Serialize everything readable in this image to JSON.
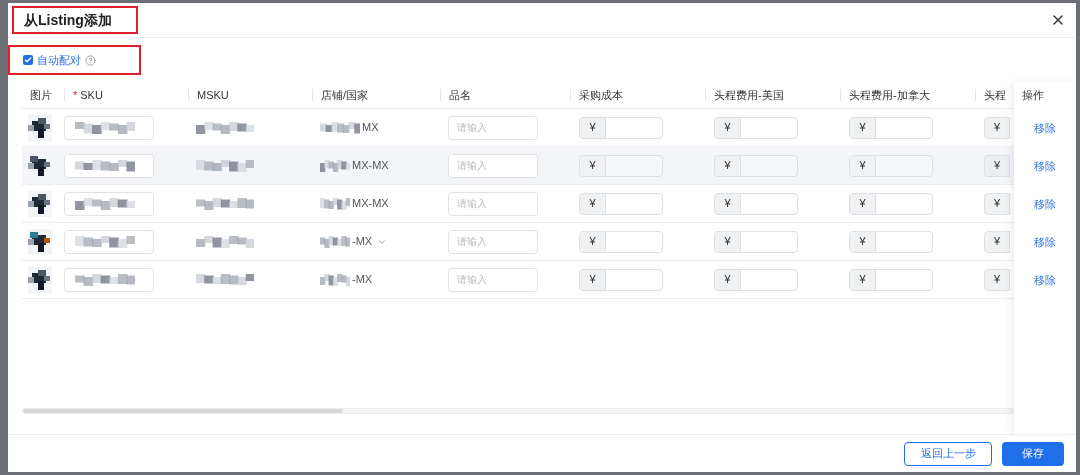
{
  "dialog": {
    "title": "从Listing添加"
  },
  "auto_match": {
    "label": "自动配对",
    "checked": true
  },
  "table": {
    "columns": [
      {
        "label": "图片"
      },
      {
        "label": "SKU",
        "kind": "sku",
        "required_mark": "*"
      },
      {
        "label": "MSKU",
        "kind": "msku"
      },
      {
        "label": "店铺/国家",
        "kind": "store"
      },
      {
        "label": "品名",
        "kind": "name"
      },
      {
        "label": "采购成本",
        "kind": "money"
      },
      {
        "label": "头程费用-美国",
        "kind": "money"
      },
      {
        "label": "头程费用-加拿大",
        "kind": "money"
      },
      {
        "label": "头程",
        "kind": "money"
      }
    ],
    "fixed_column": {
      "label": "操作"
    },
    "rows": [
      {
        "store_suffix": "MX",
        "highlighted": false,
        "name_placeholder": "请输入",
        "currency": [
          "¥",
          "¥",
          "¥",
          "¥"
        ],
        "action": "移除"
      },
      {
        "store_suffix": "MX-MX",
        "highlighted": true,
        "name_placeholder": "请输入",
        "currency": [
          "¥",
          "¥",
          "¥",
          "¥"
        ],
        "action": "移除"
      },
      {
        "store_suffix": "MX-MX",
        "highlighted": false,
        "name_placeholder": "请输入",
        "currency": [
          "¥",
          "¥",
          "¥",
          "¥"
        ],
        "action": "移除"
      },
      {
        "store_suffix": "-MX",
        "dropdown": true,
        "highlighted": false,
        "name_placeholder": "请输入",
        "currency": [
          "¥",
          "¥",
          "¥",
          "¥"
        ],
        "action": "移除"
      },
      {
        "store_suffix": "-MX",
        "highlighted": false,
        "name_placeholder": "请输入",
        "currency": [
          "¥",
          "¥",
          "¥",
          "¥"
        ],
        "action": "移除"
      }
    ]
  },
  "buttons": [
    {
      "label": "返回上一步",
      "kind": "secondary"
    },
    {
      "label": "保存",
      "kind": "primary"
    }
  ]
}
